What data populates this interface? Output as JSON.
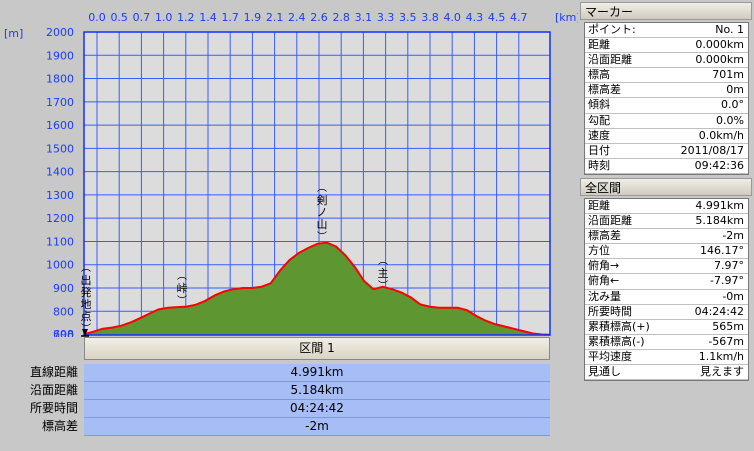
{
  "chart": {
    "y_unit": "[m]",
    "x_unit": "[km]",
    "y_ticks": [
      "2000",
      "1900",
      "1800",
      "1700",
      "1600",
      "1500",
      "1400",
      "1300",
      "1200",
      "1100",
      "1000",
      "900",
      "800",
      "700",
      "698"
    ],
    "x_ticks": [
      "0.0",
      "0.5",
      "0.7",
      "1.0",
      "1.2",
      "1.4",
      "1.7",
      "1.9",
      "2.1",
      "2.4",
      "2.6",
      "2.8",
      "3.1",
      "3.3",
      "3.5",
      "3.8",
      "4.0",
      "4.3",
      "4.5",
      "4.7"
    ],
    "labels": [
      {
        "text": "出発地点"
      },
      {
        "text": "峠"
      },
      {
        "text": "剣ノ山"
      },
      {
        "text": "主"
      }
    ],
    "colors": {
      "fill": "#5e9632",
      "line": "#ff0000",
      "grid": "#3a5cff",
      "plot_bg": "#dcdcdc"
    }
  },
  "chart_data": {
    "type": "area",
    "xlabel": "[km]",
    "ylabel": "[m]",
    "xlim": [
      0,
      4.991
    ],
    "ylim": [
      698,
      2000
    ],
    "grid": true,
    "x": [
      0.0,
      0.1,
      0.2,
      0.3,
      0.4,
      0.5,
      0.6,
      0.7,
      0.8,
      0.9,
      1.0,
      1.1,
      1.2,
      1.3,
      1.4,
      1.5,
      1.6,
      1.7,
      1.8,
      1.9,
      2.0,
      2.1,
      2.2,
      2.3,
      2.4,
      2.5,
      2.6,
      2.7,
      2.8,
      2.9,
      3.0,
      3.1,
      3.2,
      3.3,
      3.4,
      3.5,
      3.6,
      3.7,
      3.8,
      3.9,
      4.0,
      4.1,
      4.2,
      4.3,
      4.4,
      4.5,
      4.6,
      4.7,
      4.8,
      4.9,
      4.991
    ],
    "y": [
      701,
      712,
      725,
      730,
      738,
      752,
      770,
      790,
      808,
      815,
      818,
      820,
      828,
      845,
      868,
      885,
      895,
      900,
      900,
      905,
      920,
      975,
      1020,
      1050,
      1072,
      1090,
      1095,
      1078,
      1040,
      990,
      930,
      895,
      905,
      895,
      880,
      860,
      830,
      820,
      815,
      815,
      815,
      805,
      780,
      760,
      745,
      735,
      725,
      715,
      705,
      700,
      699
    ]
  },
  "section": {
    "header": "区間 1",
    "rows": [
      {
        "label": "直線距離",
        "value": "4.991km"
      },
      {
        "label": "沿面距離",
        "value": "5.184km"
      },
      {
        "label": "所要時間",
        "value": "04:24:42"
      },
      {
        "label": "標高差",
        "value": "-2m"
      }
    ]
  },
  "marker": {
    "title": "マーカー",
    "rows": [
      {
        "k": "ポイント:",
        "v": "No. 1"
      },
      {
        "k": "距離",
        "v": "0.000km"
      },
      {
        "k": "沿面距離",
        "v": "0.000km"
      },
      {
        "k": "標高",
        "v": "701m"
      },
      {
        "k": "標高差",
        "v": "0m"
      },
      {
        "k": "傾斜",
        "v": "0.0°"
      },
      {
        "k": "勾配",
        "v": "0.0%"
      },
      {
        "k": "速度",
        "v": "0.0km/h"
      },
      {
        "k": "日付",
        "v": "2011/08/17"
      },
      {
        "k": "時刻",
        "v": "09:42:36"
      }
    ]
  },
  "whole": {
    "title": "全区間",
    "rows": [
      {
        "k": "距離",
        "v": "4.991km"
      },
      {
        "k": "沿面距離",
        "v": "5.184km"
      },
      {
        "k": "標高差",
        "v": "-2m"
      },
      {
        "k": "方位",
        "v": "146.17°"
      },
      {
        "k": "俯角→",
        "v": "7.97°"
      },
      {
        "k": "俯角←",
        "v": "-7.97°"
      },
      {
        "k": "沈み量",
        "v": "-0m"
      },
      {
        "k": "所要時間",
        "v": "04:24:42"
      },
      {
        "k": "累積標高(+)",
        "v": "565m"
      },
      {
        "k": "累積標高(-)",
        "v": "-567m"
      },
      {
        "k": "平均速度",
        "v": "1.1km/h"
      },
      {
        "k": "見通し",
        "v": "見えます"
      }
    ]
  }
}
